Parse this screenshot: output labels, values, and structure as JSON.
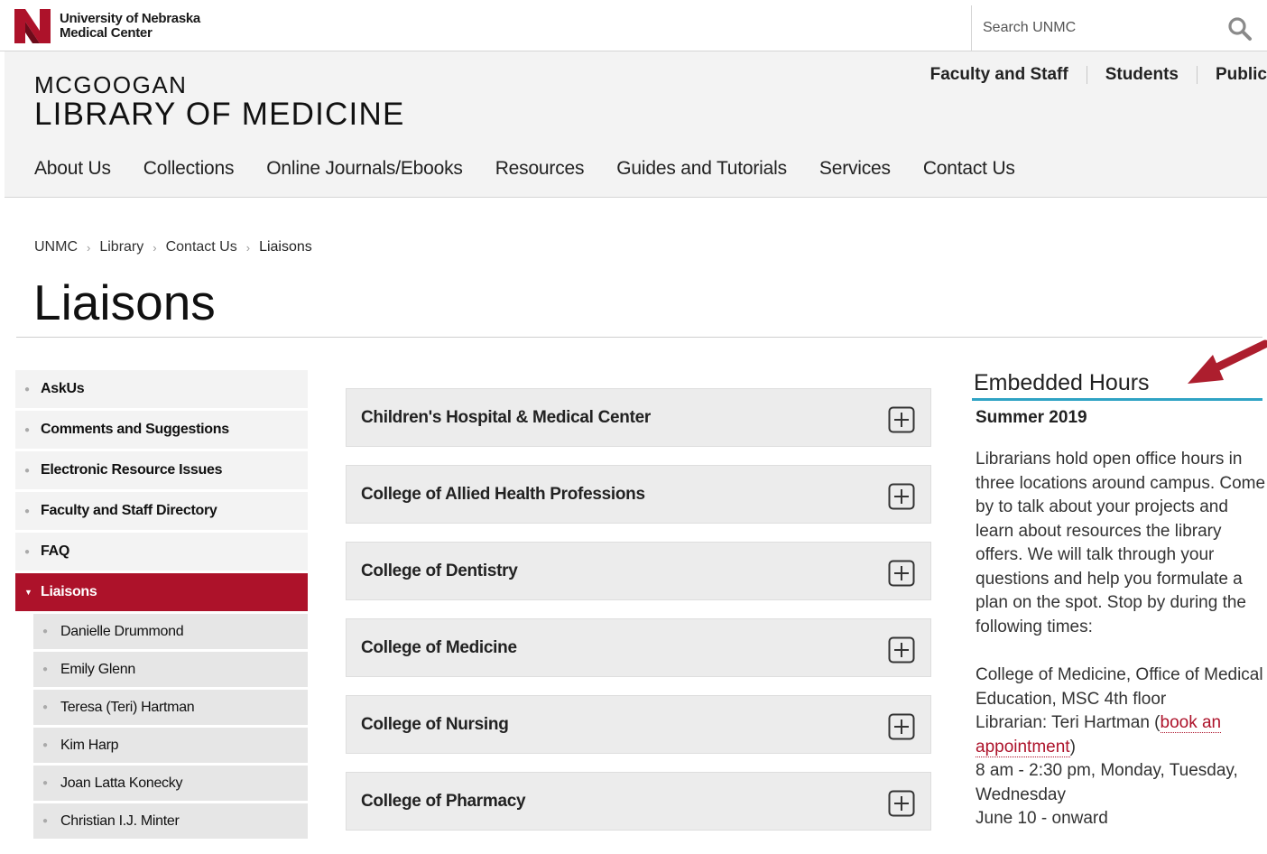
{
  "colors": {
    "brand_red": "#ad122a",
    "accent_blue": "#2fa3c4",
    "panel_gray": "#f3f3f3"
  },
  "topbar": {
    "logo_line1": "University of Nebraska",
    "logo_line2": "Medical Center",
    "search_placeholder": "Search UNMC",
    "search_icon": "search-icon"
  },
  "header": {
    "name_line1": "MCGOOGAN",
    "name_line2": "LIBRARY OF MEDICINE",
    "audience": [
      "Faculty and Staff",
      "Students",
      "Public"
    ],
    "nav": [
      "About Us",
      "Collections",
      "Online Journals/Ebooks",
      "Resources",
      "Guides and Tutorials",
      "Services",
      "Contact Us"
    ]
  },
  "breadcrumb": [
    "UNMC",
    "Library",
    "Contact Us",
    "Liaisons"
  ],
  "page_title": "Liaisons",
  "sidebar": {
    "items": [
      "AskUs",
      "Comments and Suggestions",
      "Electronic Resource Issues",
      "Faculty and Staff Directory",
      "FAQ",
      "Liaisons"
    ],
    "active": "Liaisons",
    "sub_items": [
      "Danielle Drummond",
      "Emily Glenn",
      "Teresa (Teri) Hartman",
      "Kim Harp",
      "Joan Latta Konecky",
      "Christian I.J. Minter"
    ]
  },
  "accordions": [
    "Children's Hospital & Medical Center",
    "College of Allied Health Professions",
    "College of Dentistry",
    "College of Medicine",
    "College of Nursing",
    "College of Pharmacy"
  ],
  "embedded": {
    "title": "Embedded Hours",
    "season": "Summer 2019",
    "body": "Librarians hold open office hours in three locations around campus. Come by to talk about your projects and learn about resources the library offers. We will talk through your questions and help you formulate a plan on the spot. Stop by during the following times:",
    "location_line1": "College of Medicine, Office of Medical Education, MSC 4th floor",
    "librarian_prefix": "Librarian: Teri Hartman (",
    "booking_link": "book an appointment",
    "librarian_suffix": ")",
    "hours": "8 am - 2:30 pm, Monday, Tuesday, Wednesday",
    "dates": "June 10 - onward"
  }
}
